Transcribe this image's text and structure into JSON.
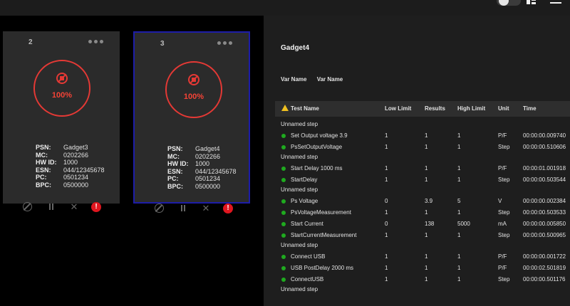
{
  "cards": [
    {
      "number": "2",
      "percent": "100%",
      "selected": false,
      "fields": [
        {
          "key": "PSN:",
          "value": "Gadget3"
        },
        {
          "key": "MC:",
          "value": "0202266"
        },
        {
          "key": "HW ID:",
          "value": "1000"
        },
        {
          "key": "ESN:",
          "value": "044/12345678"
        },
        {
          "key": "PC:",
          "value": "0501234"
        },
        {
          "key": "BPC:",
          "value": "0500000"
        }
      ],
      "alert_symbol": "!"
    },
    {
      "number": "3",
      "percent": "100%",
      "selected": true,
      "fields": [
        {
          "key": "PSN:",
          "value": "Gadget4"
        },
        {
          "key": "MC:",
          "value": "0202266"
        },
        {
          "key": "HW ID:",
          "value": "1000"
        },
        {
          "key": "ESN:",
          "value": "044/12345678"
        },
        {
          "key": "PC:",
          "value": "0501234"
        },
        {
          "key": "BPC:",
          "value": "0500000"
        }
      ],
      "alert_symbol": "!"
    }
  ],
  "detail": {
    "title": "Gadget4",
    "var_names": [
      "Var Name",
      "Var Name"
    ],
    "columns": {
      "name": "Test Name",
      "low": "Low Limit",
      "results": "Results",
      "high": "High Limit",
      "unit": "Unit",
      "time": "Time"
    },
    "groups": [
      {
        "label": "Unnamed step",
        "rows": [
          {
            "name": "Set Output voltage 3.9",
            "low": "1",
            "results": "1",
            "high": "1",
            "unit": "P/F",
            "time": "00:00:00.009740"
          },
          {
            "name": "PsSetOutputVoltage",
            "low": "1",
            "results": "1",
            "high": "1",
            "unit": "Step",
            "time": "00:00:00.510606"
          }
        ]
      },
      {
        "label": "Unnamed step",
        "rows": [
          {
            "name": "Start Delay 1000 ms",
            "low": "1",
            "results": "1",
            "high": "1",
            "unit": "P/F",
            "time": "00:00:01.001918"
          },
          {
            "name": "StartDelay",
            "low": "1",
            "results": "1",
            "high": "1",
            "unit": "Step",
            "time": "00:00:00.503544"
          }
        ]
      },
      {
        "label": "Unnamed step",
        "rows": [
          {
            "name": "Ps Voltage",
            "low": "0",
            "results": "3.9",
            "high": "5",
            "unit": "V",
            "time": "00:00:00.002384"
          },
          {
            "name": "PsVoltageMeasurement",
            "low": "1",
            "results": "1",
            "high": "1",
            "unit": "Step",
            "time": "00:00:00.503533"
          },
          {
            "name": "Start Current",
            "low": "0",
            "results": "138",
            "high": "5000",
            "unit": "mA",
            "time": "00:00:00.005850"
          },
          {
            "name": "StartCurrentMeasurement",
            "low": "1",
            "results": "1",
            "high": "1",
            "unit": "Step",
            "time": "00:00:00.500965"
          }
        ]
      },
      {
        "label": "Unnamed step",
        "rows": [
          {
            "name": "Connect USB",
            "low": "1",
            "results": "1",
            "high": "1",
            "unit": "P/F",
            "time": "00:00:00.001722"
          },
          {
            "name": "USB PostDelay 2000 ms",
            "low": "1",
            "results": "1",
            "high": "1",
            "unit": "P/F",
            "time": "00:00:02.501819"
          },
          {
            "name": "ConnectUSB",
            "low": "1",
            "results": "1",
            "high": "1",
            "unit": "Step",
            "time": "00:00:00.501176"
          }
        ]
      },
      {
        "label": "Unnamed step",
        "rows": []
      }
    ]
  },
  "colors": {
    "accent_red": "#e53935",
    "pass_green": "#1faa1f",
    "selected_border": "#1d1da8",
    "warning_yellow": "#f0c020"
  }
}
